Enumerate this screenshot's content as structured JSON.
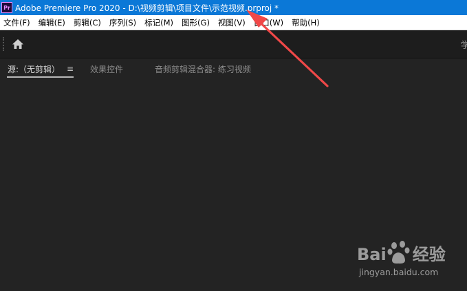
{
  "titlebar": {
    "app_badge": "Pr",
    "title": "Adobe Premiere Pro 2020 - D:\\视频剪辑\\项目文件\\示范视频.prproj *"
  },
  "menubar": {
    "items": [
      {
        "label": "文件(F)"
      },
      {
        "label": "编辑(E)"
      },
      {
        "label": "剪辑(C)"
      },
      {
        "label": "序列(S)"
      },
      {
        "label": "标记(M)"
      },
      {
        "label": "图形(G)"
      },
      {
        "label": "视图(V)"
      },
      {
        "label": "窗口(W)"
      },
      {
        "label": "帮助(H)"
      }
    ]
  },
  "toolbar": {
    "home_icon": "home-icon",
    "right_label": "学"
  },
  "panel": {
    "tabs": [
      {
        "label": "源:（无剪辑）",
        "active": true
      },
      {
        "label": "效果控件",
        "active": false
      },
      {
        "label": "音频剪辑混合器: 练习视频",
        "active": false
      }
    ],
    "tab_menu_icon": "≡"
  },
  "watermark": {
    "logo_left": "Bai",
    "logo_right": "经验",
    "url": "jingyan.baidu.com"
  },
  "colors": {
    "titlebar": "#0b78d7",
    "panel_bg": "#232323",
    "toolbar_bg": "#1d1d1d",
    "arrow": "#f04848"
  }
}
